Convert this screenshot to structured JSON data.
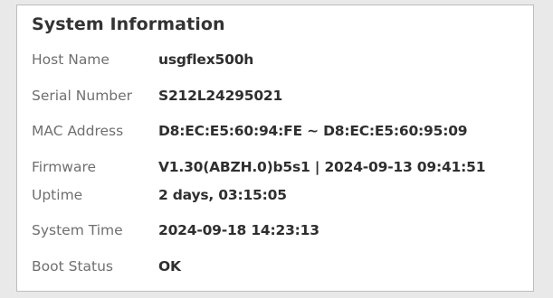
{
  "panel": {
    "title": "System Information",
    "rows": [
      {
        "label": "Host Name",
        "value": "usgflex500h"
      },
      {
        "label": "Serial Number",
        "value": "S212L24295021"
      },
      {
        "label": "MAC Address",
        "value": "D8:EC:E5:60:94:FE ~ D8:EC:E5:60:95:09"
      },
      {
        "label": "Firmware",
        "value": "V1.30(ABZH.0)b5s1 | 2024-09-13 09:41:51"
      },
      {
        "label": "Uptime",
        "value": "2 days, 03:15:05"
      },
      {
        "label": "System Time",
        "value": "2024-09-18 14:23:13"
      },
      {
        "label": "Boot Status",
        "value": "OK"
      }
    ]
  },
  "colors": {
    "panel_background": "#ffffff",
    "panel_border": "#bdbdbd",
    "label_text": "#6f6f6f",
    "value_text": "#2f2f2f"
  }
}
